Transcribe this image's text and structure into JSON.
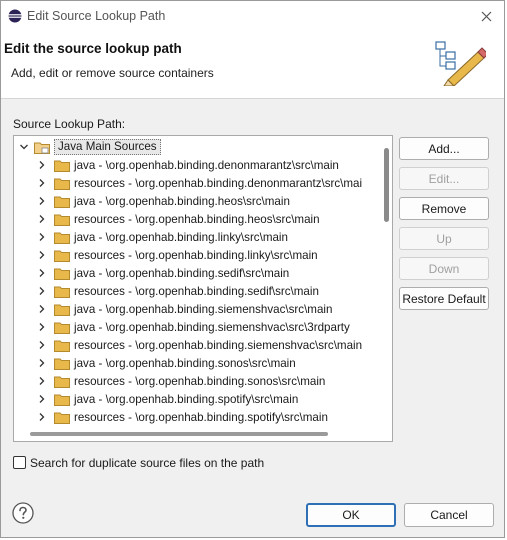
{
  "window": {
    "title": "Edit Source Lookup Path"
  },
  "header": {
    "title": "Edit the source lookup path",
    "subtitle": "Add, edit or remove source containers"
  },
  "tree": {
    "label": "Source Lookup Path:",
    "root": "Java Main Sources",
    "items": [
      "java - \\org.openhab.binding.denonmarantz\\src\\main",
      "resources - \\org.openhab.binding.denonmarantz\\src\\mai",
      "java - \\org.openhab.binding.heos\\src\\main",
      "resources - \\org.openhab.binding.heos\\src\\main",
      "java - \\org.openhab.binding.linky\\src\\main",
      "resources - \\org.openhab.binding.linky\\src\\main",
      "java - \\org.openhab.binding.sedif\\src\\main",
      "resources - \\org.openhab.binding.sedif\\src\\main",
      "java - \\org.openhab.binding.siemenshvac\\src\\main",
      "java - \\org.openhab.binding.siemenshvac\\src\\3rdparty",
      "resources - \\org.openhab.binding.siemenshvac\\src\\main",
      "java - \\org.openhab.binding.sonos\\src\\main",
      "resources - \\org.openhab.binding.sonos\\src\\main",
      "java - \\org.openhab.binding.spotify\\src\\main",
      "resources - \\org.openhab.binding.spotify\\src\\main"
    ]
  },
  "buttons": {
    "add": "Add...",
    "edit": "Edit...",
    "remove": "Remove",
    "up": "Up",
    "down": "Down",
    "restore": "Restore Default"
  },
  "options": {
    "duplicate_label": "Search for duplicate source files on the path",
    "duplicate_checked": false
  },
  "footer": {
    "ok": "OK",
    "cancel": "Cancel"
  },
  "colors": {
    "accent": "#2f6fb5",
    "folder": "#e8b84a"
  }
}
